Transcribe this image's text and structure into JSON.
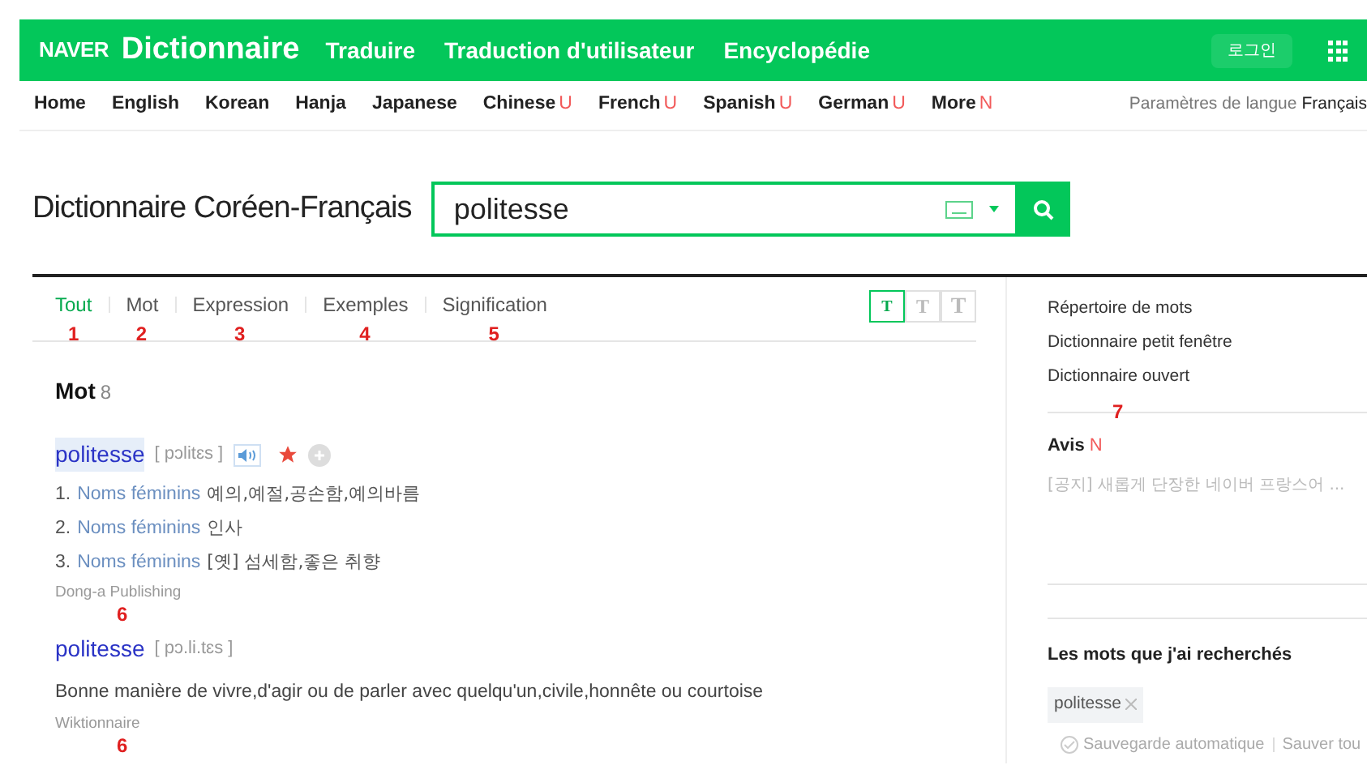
{
  "header": {
    "logo": "NAVER",
    "brand": "Dictionnaire",
    "links": [
      "Traduire",
      "Traduction d'utilisateur",
      "Encyclopédie"
    ],
    "login": "로그인"
  },
  "language_nav": {
    "items": [
      {
        "label": "Home"
      },
      {
        "label": "English"
      },
      {
        "label": "Korean"
      },
      {
        "label": "Hanja"
      },
      {
        "label": "Japanese"
      },
      {
        "label": "Chinese",
        "badge": "U"
      },
      {
        "label": "French",
        "badge": "U"
      },
      {
        "label": "Spanish",
        "badge": "U"
      },
      {
        "label": "German",
        "badge": "U"
      },
      {
        "label": "More",
        "badge": "N"
      }
    ],
    "settings_label": "Paramètres de langue",
    "settings_value": "Français"
  },
  "title": "Dictionnaire Coréen-Français",
  "search": {
    "value": "politesse"
  },
  "tabs": [
    {
      "label": "Tout",
      "selected": true,
      "annotation": "1"
    },
    {
      "label": "Mot",
      "selected": false,
      "annotation": "2"
    },
    {
      "label": "Expression",
      "selected": false,
      "annotation": "3"
    },
    {
      "label": "Exemples",
      "selected": false,
      "annotation": "4"
    },
    {
      "label": "Signification",
      "selected": false,
      "annotation": "5"
    }
  ],
  "font_sizes": [
    {
      "label": "T",
      "selected": true
    },
    {
      "label": "T",
      "selected": false
    },
    {
      "label": "T",
      "selected": false
    }
  ],
  "section": {
    "title": "Mot",
    "count": "8"
  },
  "entries": [
    {
      "word": "politesse",
      "highlighted": true,
      "pronunciation": "[ pɔlitɛs ]",
      "audio": true,
      "starred": true,
      "senses": [
        {
          "number": "1.",
          "pos": "Noms féminins",
          "meaning": "예의,예절,공손함,예의바름"
        },
        {
          "number": "2.",
          "pos": "Noms féminins",
          "meaning": "인사"
        },
        {
          "number": "3.",
          "pos": "Noms féminins",
          "meaning": "[옛] 섬세함,좋은 취향"
        }
      ],
      "source": "Dong-a Publishing",
      "annotation": "6"
    },
    {
      "word": "politesse",
      "highlighted": false,
      "pronunciation": "[ pɔ.li.tɛs ]",
      "definition": "Bonne manière de vivre,d'agir ou de parler avec quelqu'un,civile,honnête ou courtoise",
      "source": "Wiktionnaire",
      "annotation": "6"
    }
  ],
  "sidebar": {
    "links": [
      "Répertoire de mots",
      "Dictionnaire petit fenêtre",
      "Dictionnaire ouvert"
    ],
    "annotation": "7",
    "notice_title": "Avis",
    "notice_badge": "N",
    "notice_text": "[공지] 새롭게 단장한 네이버 프랑스어 ...",
    "history_title": "Les mots que j'ai recherchés",
    "history": [
      "politesse"
    ],
    "autosave_label": "Sauvegarde automatique",
    "save_all": "Sauver tou"
  }
}
